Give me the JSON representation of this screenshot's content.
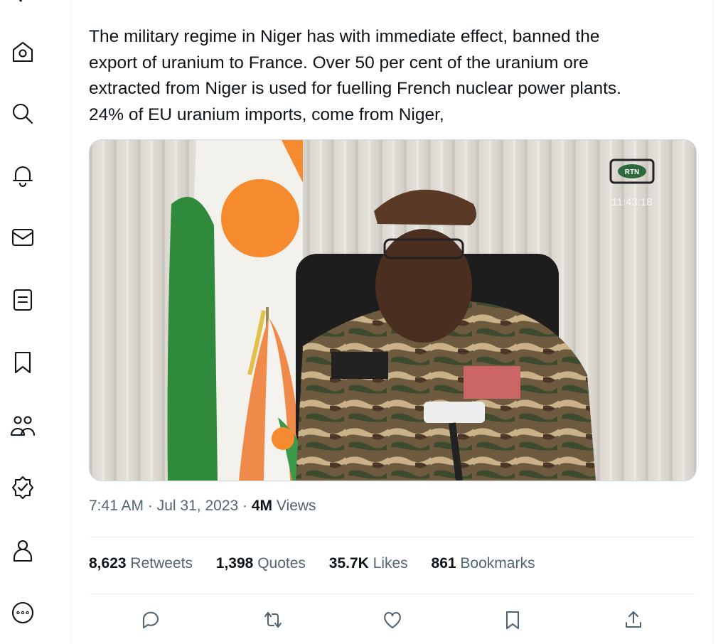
{
  "nav": {
    "items": [
      "home",
      "explore",
      "notifications",
      "messages",
      "lists",
      "bookmarks",
      "communities",
      "verified",
      "profile",
      "more"
    ]
  },
  "tweet": {
    "text_lines": [
      "The military regime in Niger has with immediate effect, banned the",
      "export of uranium to France. Over 50 per cent of the uranium ore",
      "extracted from Niger is used for fuelling French nuclear power plants.",
      "24% of EU uranium imports, come from Niger,"
    ],
    "media": {
      "logo_text": "RTN",
      "timestamp_text": "11:43:18"
    },
    "time": "7:41 AM",
    "sep1": "·",
    "date": "Jul 31, 2023",
    "sep2": "·",
    "views_count": "4M",
    "views_label": "Views",
    "stats": {
      "retweets": {
        "count": "8,623",
        "label": "Retweets"
      },
      "quotes": {
        "count": "1,398",
        "label": "Quotes"
      },
      "likes": {
        "count": "35.7K",
        "label": "Likes"
      },
      "bookmarks": {
        "count": "861",
        "label": "Bookmarks"
      }
    }
  },
  "colors": {
    "text": "#0f1419",
    "secondary": "#536471",
    "border": "#eff3f4",
    "niger_orange": "#f58a2f",
    "niger_green": "#2f8a3c"
  }
}
